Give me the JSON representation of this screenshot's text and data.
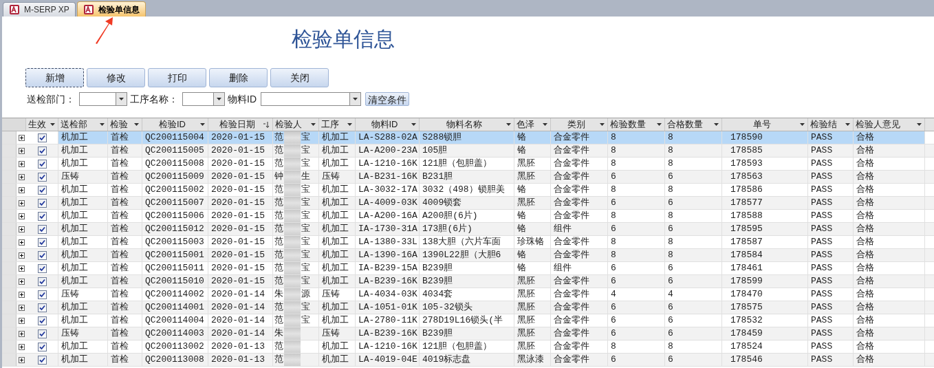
{
  "tabs": [
    {
      "label": "M-SERP XP",
      "selected": false
    },
    {
      "label": "检验单信息",
      "selected": true
    }
  ],
  "title": "检验单信息",
  "buttons": [
    {
      "label": "新增",
      "focused": true
    },
    {
      "label": "修改",
      "focused": false
    },
    {
      "label": "打印",
      "focused": false
    },
    {
      "label": "删除",
      "focused": false
    },
    {
      "label": "关闭",
      "focused": false
    }
  ],
  "filters": [
    {
      "kind": "combo",
      "label": "送检部门："
    },
    {
      "kind": "combo",
      "label": "工序名称："
    },
    {
      "kind": "combo",
      "label": "物料ID"
    },
    {
      "kind": "button",
      "label": "清空条件"
    }
  ],
  "table": {
    "columns": [
      {
        "label": "生效",
        "sorted_descending": false
      },
      {
        "label": "送检部",
        "sorted_descending": false
      },
      {
        "label": "检验",
        "sorted_descending": false
      },
      {
        "label": "检验ID",
        "sorted_descending": false
      },
      {
        "label": "检验日期",
        "sorted_descending": true
      },
      {
        "label": "检验人",
        "sorted_descending": false
      },
      {
        "label": "工序",
        "sorted_descending": false
      },
      {
        "label": "物料ID",
        "sorted_descending": false
      },
      {
        "label": "物料名称",
        "sorted_descending": false
      },
      {
        "label": "色泽",
        "sorted_descending": false
      },
      {
        "label": "类别",
        "sorted_descending": false
      },
      {
        "label": "检验数量",
        "sorted_descending": false
      },
      {
        "label": "合格数量",
        "sorted_descending": false
      },
      {
        "label": "单号",
        "sorted_descending": false
      },
      {
        "label": "检验结",
        "sorted_descending": false
      },
      {
        "label": "检验人意见",
        "sorted_descending": false
      }
    ],
    "rows": [
      {
        "selected": true,
        "cells": [
          {
            "checked": true
          },
          "机加工",
          "首检",
          "QC200115004",
          "2020-01-15",
          [
            "范",
            "宝"
          ],
          "机加工",
          "LA-S288-02A",
          "S288锁胆",
          "铬",
          "合金零件",
          "8",
          "8",
          "178590",
          "PASS",
          "合格"
        ]
      },
      {
        "selected": false,
        "cells": [
          {
            "checked": true
          },
          "机加工",
          "首检",
          "QC200115005",
          "2020-01-15",
          [
            "范",
            "宝"
          ],
          "机加工",
          "LA-A200-23A",
          "105胆",
          "铬",
          "合金零件",
          "8",
          "8",
          "178585",
          "PASS",
          "合格"
        ]
      },
      {
        "selected": false,
        "cells": [
          {
            "checked": true
          },
          "机加工",
          "首检",
          "QC200115008",
          "2020-01-15",
          [
            "范",
            "宝"
          ],
          "机加工",
          "LA-1210-16K",
          "121胆（包胆盖）",
          "黑胚",
          "合金零件",
          "8",
          "8",
          "178593",
          "PASS",
          "合格"
        ]
      },
      {
        "selected": false,
        "cells": [
          {
            "checked": true
          },
          "压铸",
          "首检",
          "QC200115009",
          "2020-01-15",
          [
            "钟",
            "生"
          ],
          "压铸",
          "LA-B231-16K",
          "B231胆",
          "黑胚",
          "合金零件",
          "6",
          "6",
          "178563",
          "PASS",
          "合格"
        ]
      },
      {
        "selected": false,
        "cells": [
          {
            "checked": true
          },
          "机加工",
          "首检",
          "QC200115002",
          "2020-01-15",
          [
            "范",
            "宝"
          ],
          "机加工",
          "LA-3032-17A",
          "3032（498）锁胆美",
          "铬",
          "合金零件",
          "8",
          "8",
          "178586",
          "PASS",
          "合格"
        ]
      },
      {
        "selected": false,
        "cells": [
          {
            "checked": true
          },
          "机加工",
          "首检",
          "QC200115007",
          "2020-01-15",
          [
            "范",
            "宝"
          ],
          "机加工",
          "LA-4009-03K",
          "4009锁套",
          "黑胚",
          "合金零件",
          "6",
          "6",
          "178577",
          "PASS",
          "合格"
        ]
      },
      {
        "selected": false,
        "cells": [
          {
            "checked": true
          },
          "机加工",
          "首检",
          "QC200115006",
          "2020-01-15",
          [
            "范",
            "宝"
          ],
          "机加工",
          "LA-A200-16A",
          "A200胆(6片)",
          "铬",
          "合金零件",
          "8",
          "8",
          "178588",
          "PASS",
          "合格"
        ]
      },
      {
        "selected": false,
        "cells": [
          {
            "checked": true
          },
          "机加工",
          "首检",
          "QC200115012",
          "2020-01-15",
          [
            "范",
            "宝"
          ],
          "机加工",
          "IA-1730-31A",
          "173胆(6片)",
          "铬",
          "组件",
          "6",
          "6",
          "178595",
          "PASS",
          "合格"
        ]
      },
      {
        "selected": false,
        "cells": [
          {
            "checked": true
          },
          "机加工",
          "首检",
          "QC200115003",
          "2020-01-15",
          [
            "范",
            "宝"
          ],
          "机加工",
          "LA-1380-33L",
          "138大胆（六片车面",
          "珍珠铬",
          "合金零件",
          "8",
          "8",
          "178587",
          "PASS",
          "合格"
        ]
      },
      {
        "selected": false,
        "cells": [
          {
            "checked": true
          },
          "机加工",
          "首检",
          "QC200115001",
          "2020-01-15",
          [
            "范",
            "宝"
          ],
          "机加工",
          "LA-1390-16A",
          "1390L22胆（大胆6",
          "铬",
          "合金零件",
          "8",
          "8",
          "178584",
          "PASS",
          "合格"
        ]
      },
      {
        "selected": false,
        "cells": [
          {
            "checked": true
          },
          "机加工",
          "首检",
          "QC200115011",
          "2020-01-15",
          [
            "范",
            "宝"
          ],
          "机加工",
          "IA-B239-15A",
          "B239胆",
          "铬",
          "组件",
          "6",
          "6",
          "178461",
          "PASS",
          "合格"
        ]
      },
      {
        "selected": false,
        "cells": [
          {
            "checked": true
          },
          "机加工",
          "首检",
          "QC200115010",
          "2020-01-15",
          [
            "范",
            "宝"
          ],
          "机加工",
          "LA-B239-16K",
          "B239胆",
          "黑胚",
          "合金零件",
          "6",
          "6",
          "178599",
          "PASS",
          "合格"
        ]
      },
      {
        "selected": false,
        "cells": [
          {
            "checked": true
          },
          "压铸",
          "首检",
          "QC200114002",
          "2020-01-14",
          [
            "朱",
            "源"
          ],
          "压铸",
          "LA-4034-03K",
          "4034套",
          "黑胚",
          "合金零件",
          "4",
          "4",
          "178470",
          "PASS",
          "合格"
        ]
      },
      {
        "selected": false,
        "cells": [
          {
            "checked": true
          },
          "机加工",
          "首检",
          "QC200114001",
          "2020-01-14",
          [
            "范",
            "宝"
          ],
          "机加工",
          "LA-1051-01K",
          "105-32锁头",
          "黑胚",
          "合金零件",
          "6",
          "6",
          "178575",
          "PASS",
          "合格"
        ]
      },
      {
        "selected": false,
        "cells": [
          {
            "checked": true
          },
          "机加工",
          "首检",
          "QC200114004",
          "2020-01-14",
          [
            "范",
            "宝"
          ],
          "机加工",
          "LA-2780-11K",
          "278D19L16锁头(半",
          "黑胚",
          "合金零件",
          "6",
          "6",
          "178532",
          "PASS",
          "合格"
        ]
      },
      {
        "selected": false,
        "cells": [
          {
            "checked": true
          },
          "压铸",
          "首检",
          "QC200114003",
          "2020-01-14",
          [
            "朱"
          ],
          "压铸",
          "LA-B239-16K",
          "B239胆",
          "黑胚",
          "合金零件",
          "6",
          "6",
          "178459",
          "PASS",
          "合格"
        ]
      },
      {
        "selected": false,
        "cells": [
          {
            "checked": true
          },
          "机加工",
          "首检",
          "QC200113002",
          "2020-01-13",
          [
            "范"
          ],
          "机加工",
          "LA-1210-16K",
          "121胆（包胆盖）",
          "黑胚",
          "合金零件",
          "8",
          "8",
          "178524",
          "PASS",
          "合格"
        ]
      },
      {
        "selected": false,
        "cells": [
          {
            "checked": true
          },
          "机加工",
          "首检",
          "QC200113008",
          "2020-01-13",
          [
            "范"
          ],
          "机加工",
          "LA-4019-04E",
          "4019标志盘",
          "黑泳漆",
          "合金零件",
          "6",
          "6",
          "178546",
          "PASS",
          "合格"
        ]
      }
    ]
  }
}
